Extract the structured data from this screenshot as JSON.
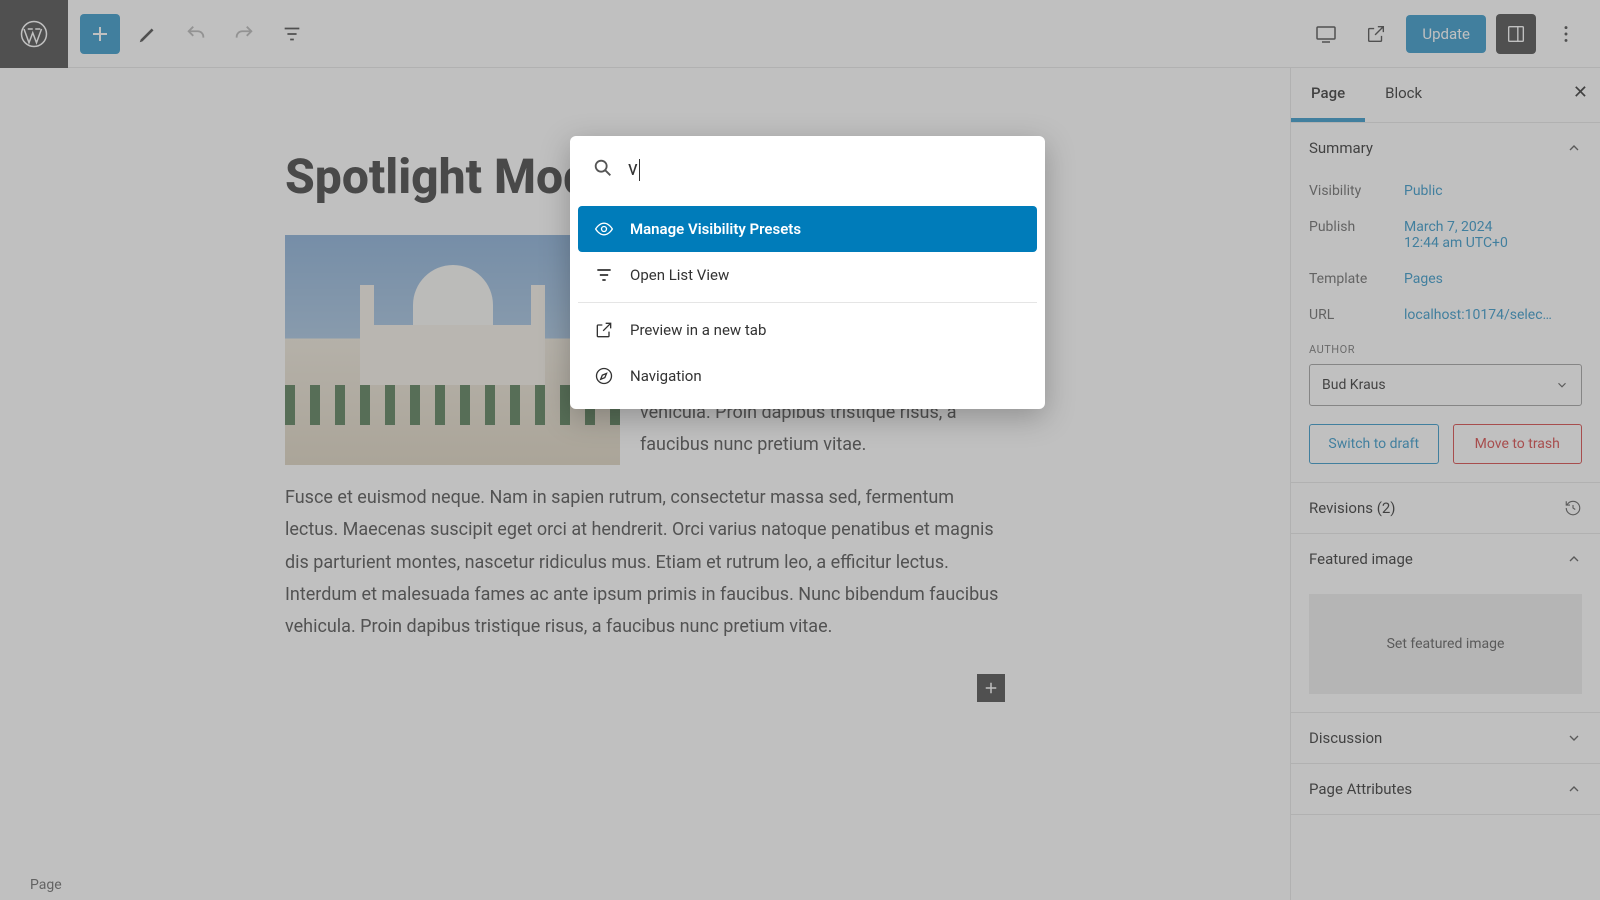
{
  "toolbar": {
    "update_label": "Update"
  },
  "canvas": {
    "title": "Spotlight Mode",
    "para1": "varius natoque penatibus et magnis dis parturient montes, nascetur ridiculus mus. Etiam et rutrum leo, a efficitur lectus. Interdum et malesuada fames ac ante ipsum primis in faucibus. Nunc bibendum faucibus vehicula. Proin dapibus tristique risus, a faucibus nunc pretium vitae.",
    "para2": "Fusce et euismod neque. Nam in sapien rutrum, consectetur massa sed, fermentum lectus. Maecenas suscipit eget orci at hendrerit. Orci varius natoque penatibus et magnis dis parturient montes, nascetur ridiculus mus. Etiam et rutrum leo, a efficitur lectus. Interdum et malesuada fames ac ante ipsum primis in faucibus. Nunc bibendum faucibus vehicula. Proin dapibus tristique risus, a faucibus nunc pretium vitae."
  },
  "palette": {
    "query": "v",
    "items": [
      {
        "label": "Manage Visibility Presets"
      },
      {
        "label": "Open List View"
      },
      {
        "label": "Preview in a new tab"
      },
      {
        "label": "Navigation"
      }
    ]
  },
  "sidebar": {
    "tabs": {
      "page": "Page",
      "block": "Block"
    },
    "summary": {
      "heading": "Summary",
      "visibility_label": "Visibility",
      "visibility_value": "Public",
      "publish_label": "Publish",
      "publish_value_line1": "March 7, 2024",
      "publish_value_line2": "12:44 am UTC+0",
      "template_label": "Template",
      "template_value": "Pages",
      "url_label": "URL",
      "url_value": "localhost:10174/selec…",
      "author_label": "AUTHOR",
      "author_value": "Bud Kraus",
      "switch_draft": "Switch to draft",
      "move_trash": "Move to trash"
    },
    "revisions": "Revisions (2)",
    "featured": {
      "heading": "Featured image",
      "placeholder": "Set featured image"
    },
    "discussion": "Discussion",
    "attributes": "Page Attributes"
  },
  "footer": {
    "crumb": "Page"
  }
}
